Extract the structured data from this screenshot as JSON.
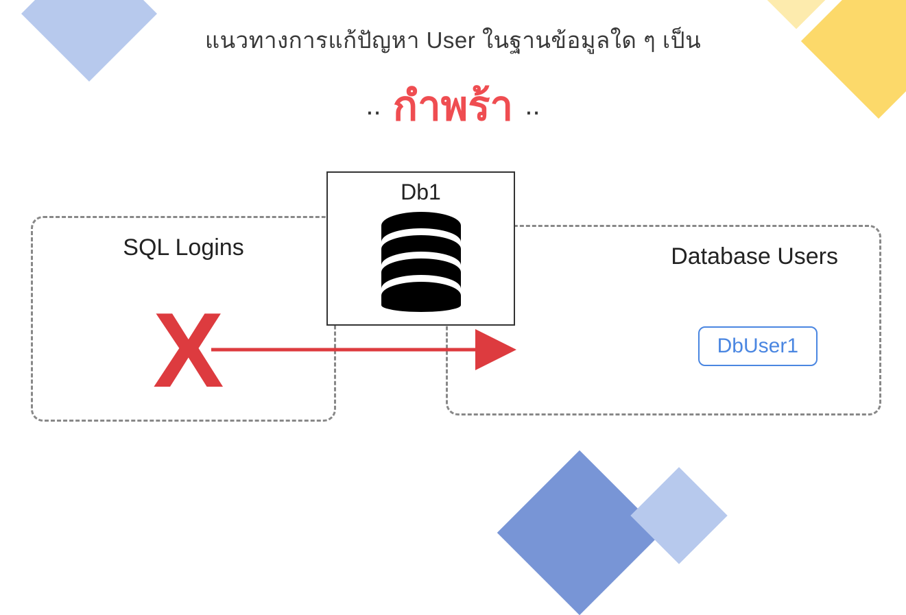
{
  "title": {
    "line1": "แนวทางการแก้ปัญหา User ในฐานข้อมูลใด ๆ เป็น",
    "dots_left": "..",
    "orphan_word": "กำพร้า",
    "dots_right": ".."
  },
  "diagram": {
    "sql_logins_label": "SQL Logins",
    "sql_cross_symbol": "X",
    "db1_label": "Db1",
    "database_users_label": "Database Users",
    "dbuser1_label": "DbUser1"
  },
  "colors": {
    "accent_red": "#ef4d51",
    "dark_red": "#dd3b3f",
    "blue": "#4a86e1",
    "deco_blue_light": "#b7c9ed",
    "deco_blue": "#7895d6",
    "deco_yellow": "#fcd96a",
    "deco_yellow_light": "#fdebad"
  }
}
